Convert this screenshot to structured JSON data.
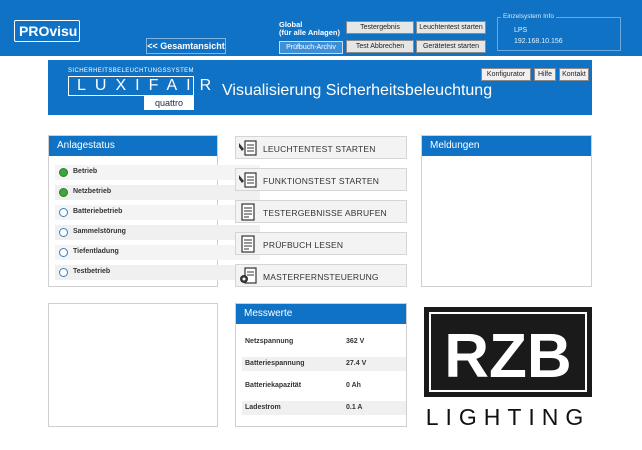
{
  "topbar": {
    "brand": "PROvisu",
    "back_link": "<< Gesamtansicht",
    "global_label": "Global\n(für alle Anlagen)",
    "buttons": {
      "testergebnis": "Testergebnis",
      "pruefbuch_archiv": "Prüfbuch-Archiv",
      "leuchtentest_starten": "Leuchtentest starten",
      "test_abbrechen": "Test Abbrechen",
      "geraetetest_starten": "Gerätetest starten"
    },
    "single_system": {
      "title": "Einzelsystem Info",
      "line1": "LPS",
      "line2": "192.168.10.156"
    }
  },
  "banner": {
    "subtitle": "SICHERHEITSBELEUCHTUNGSSYSTEM",
    "product": "LUXIFAIR",
    "variant": "quattro",
    "title": "Visualisierung Sicherheitsbeleuchtung",
    "buttons": {
      "konfigurator": "Konfigurator",
      "hilfe": "Hilfe",
      "kontakt": "Kontakt"
    }
  },
  "anlagestatus": {
    "title": "Anlagestatus",
    "items": [
      {
        "label": "Betrieb",
        "state": "active"
      },
      {
        "label": "Netzbetrieb",
        "state": "active"
      },
      {
        "label": "Batteriebetrieb",
        "state": "inactive"
      },
      {
        "label": "Sammelstörung",
        "state": "inactive"
      },
      {
        "label": "Tiefentladung",
        "state": "inactive"
      },
      {
        "label": "Testbetrieb",
        "state": "inactive"
      }
    ]
  },
  "actions": {
    "leuchtentest": "LEUCHTENTEST STARTEN",
    "funktionstest": "FUNKTIONSTEST STARTEN",
    "testergebnisse": "TESTERGEBNISSE ABRUFEN",
    "pruefbuch": "PRÜFBUCH LESEN",
    "masterfern": "MASTERFERNSTEUERUNG"
  },
  "meldungen": {
    "title": "Meldungen"
  },
  "messwerte": {
    "title": "Messwerte",
    "rows": [
      {
        "label": "Netzspannung",
        "value": "362 V"
      },
      {
        "label": "Batteriespannung",
        "value": "27.4 V"
      },
      {
        "label": "Batteriekapazität",
        "value": "0 Ah"
      },
      {
        "label": "Ladestrom",
        "value": "0.1 A"
      }
    ]
  },
  "logo": {
    "mark": "RZB",
    "wordmark": "LIGHTING"
  },
  "colors": {
    "primary": "#1072c4",
    "status_green": "#3fa33f",
    "status_empty_ring": "#3b7fc4"
  }
}
